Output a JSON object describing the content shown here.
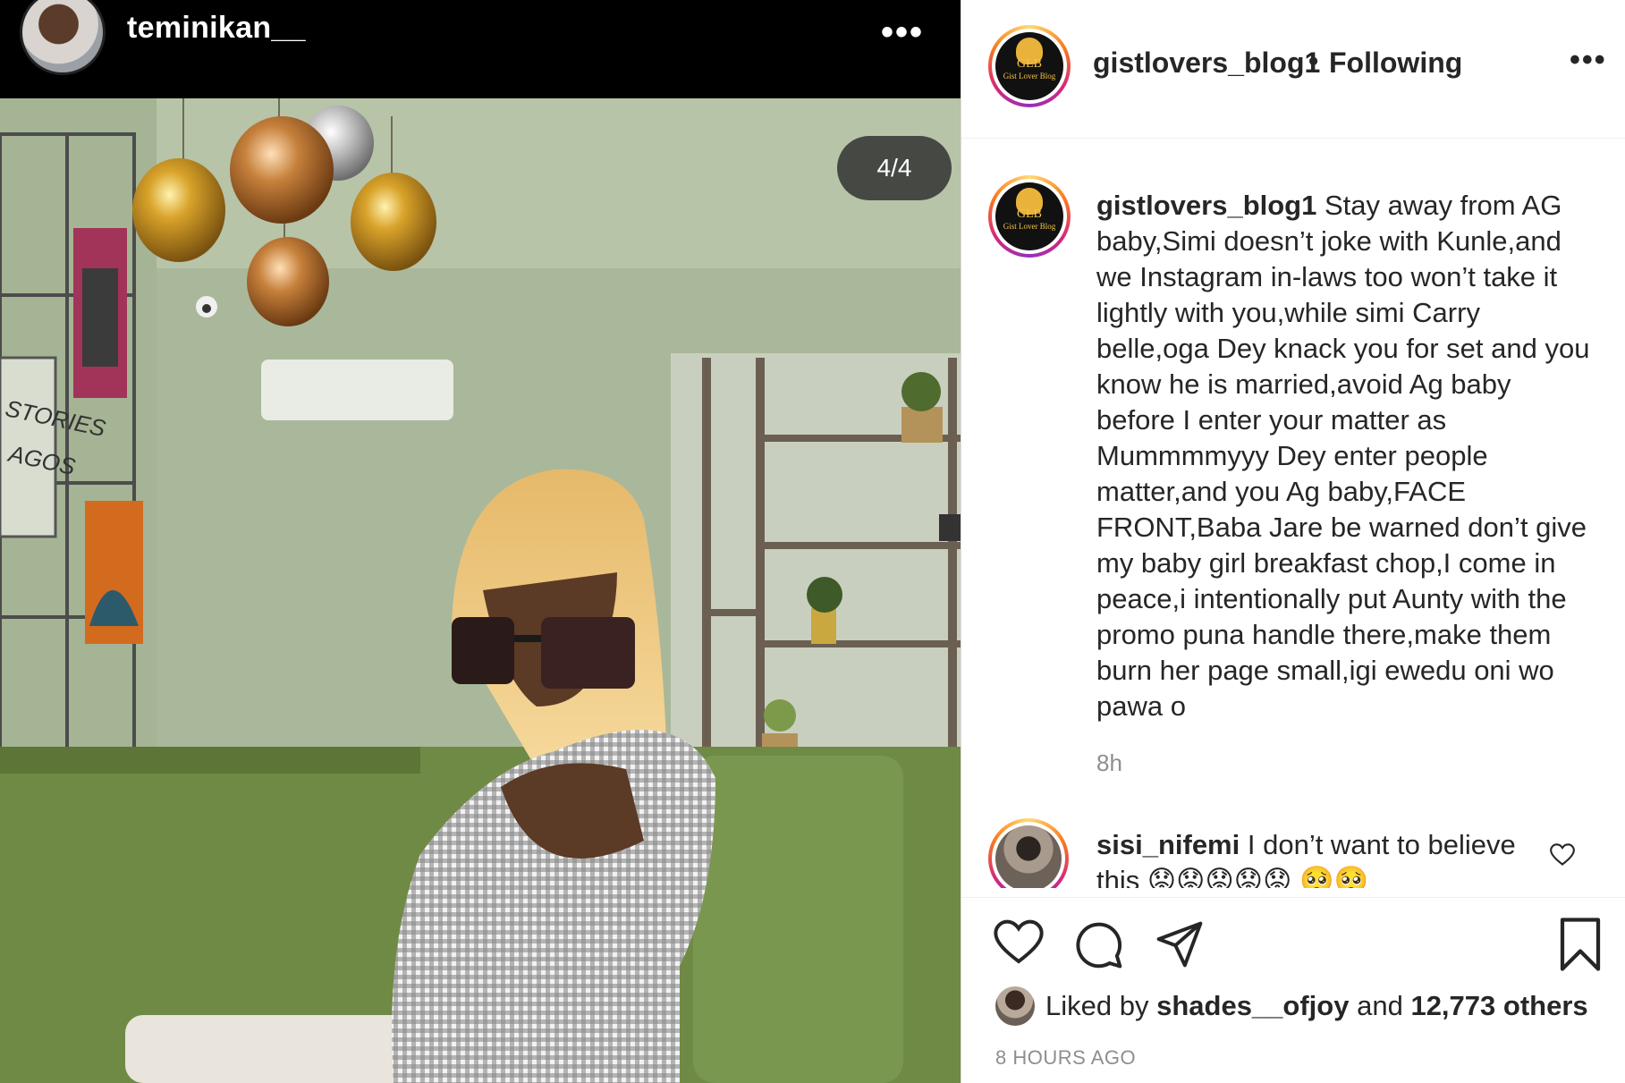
{
  "story": {
    "username": "teminikan__",
    "more_glyph": "•••",
    "counter": "4/4",
    "wall_sign_line1": "STORIES",
    "wall_sign_line2": "AGOS"
  },
  "post": {
    "header": {
      "username": "gistlovers_blog1",
      "separator": "•",
      "follow_status": "Following",
      "more_glyph": "•••",
      "avatar_logo_text": "GLB",
      "avatar_logo_subtext": "Gist Lover Blog"
    },
    "caption": {
      "username": "gistlovers_blog1",
      "text": "Stay away from AG baby,Simi doesn’t joke with Kunle,and we Instagram in-laws too won’t take it lightly with you,while simi Carry belle,oga Dey knack you for set and you know he is married,avoid Ag baby before I enter your matter as Mummmmyyy Dey enter people matter,and you Ag baby,FACE FRONT,Baba Jare be warned don’t give my baby girl breakfast chop,I come in peace,i intentionally put Aunty with the promo puna handle there,make them burn her page small,igi ewedu oni wo pawa o",
      "time": "8h"
    },
    "comment": {
      "username": "sisi_nifemi",
      "text": "I don’t want to believe this 😟😟😟😟😟 🥺🥺"
    },
    "likes": {
      "prefix": "Liked by",
      "liker": "shades__ofjoy",
      "conjunction": "and",
      "others": "12,773 others"
    },
    "timestamp": "8 HOURS AGO"
  },
  "colors": {
    "story_ring": [
      "#feda75",
      "#fa7e1e",
      "#d62976",
      "#962fbf"
    ],
    "text_primary": "#262626",
    "text_secondary": "#8e8e8e",
    "wall_green": "#a9b89a",
    "sofa_green": "#6f8a45"
  },
  "icons": [
    "heart-icon",
    "comment-icon",
    "share-icon",
    "bookmark-icon",
    "comment-like-icon",
    "more-options-icon"
  ]
}
